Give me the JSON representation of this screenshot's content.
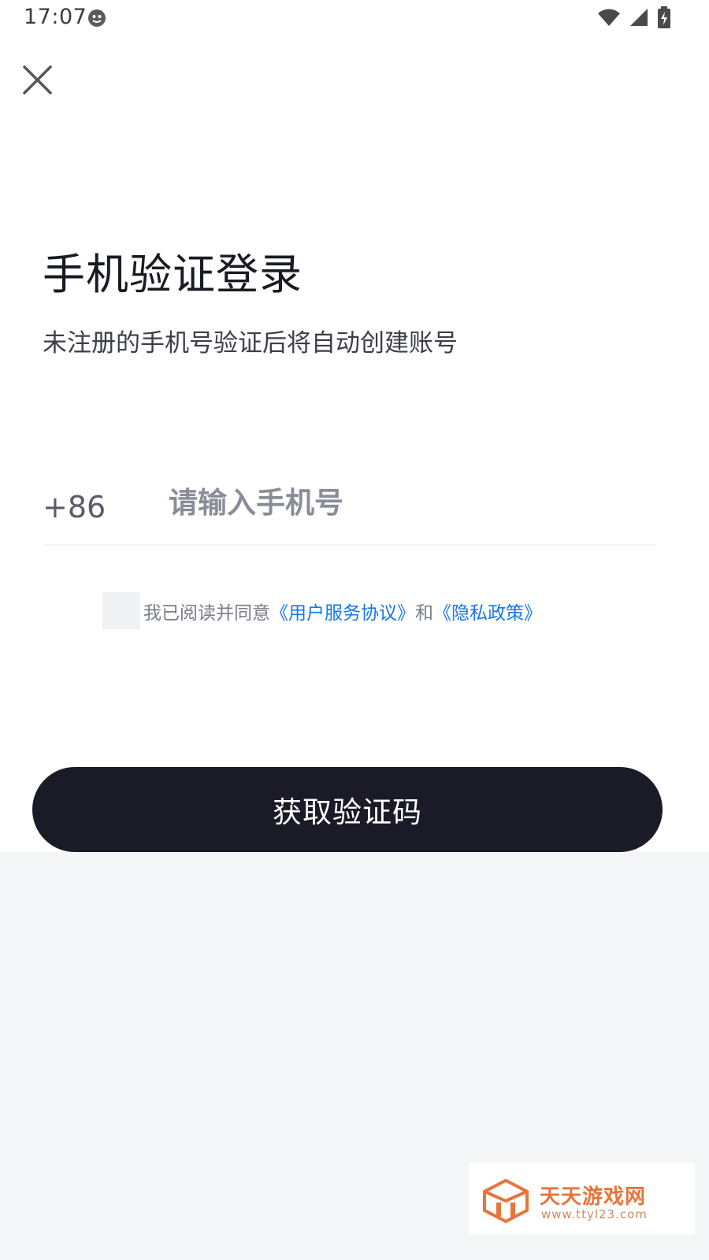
{
  "status_bar": {
    "time": "17:07",
    "icons": [
      "app-notification-icon",
      "wifi-icon",
      "signal-icon",
      "battery-charging-icon"
    ]
  },
  "header": {
    "close_icon": "close-icon"
  },
  "login": {
    "title": "手机验证登录",
    "subtitle": "未注册的手机号验证后将自动创建账号",
    "country_code": "+86",
    "phone_placeholder": "请输入手机号",
    "phone_value": "",
    "agreement": {
      "checked": false,
      "prefix": "我已阅读并同意",
      "terms_link": "《用户服务协议》",
      "conjunction": "和",
      "privacy_link": "《隐私政策》"
    },
    "submit_label": "获取验证码"
  },
  "watermark": {
    "title": "天天游戏网",
    "url": "www.ttyl23.com"
  },
  "colors": {
    "button_bg": "#1a1b26",
    "link": "#1678e6",
    "text_primary": "#1a1b22",
    "watermark": "#e8743a"
  }
}
